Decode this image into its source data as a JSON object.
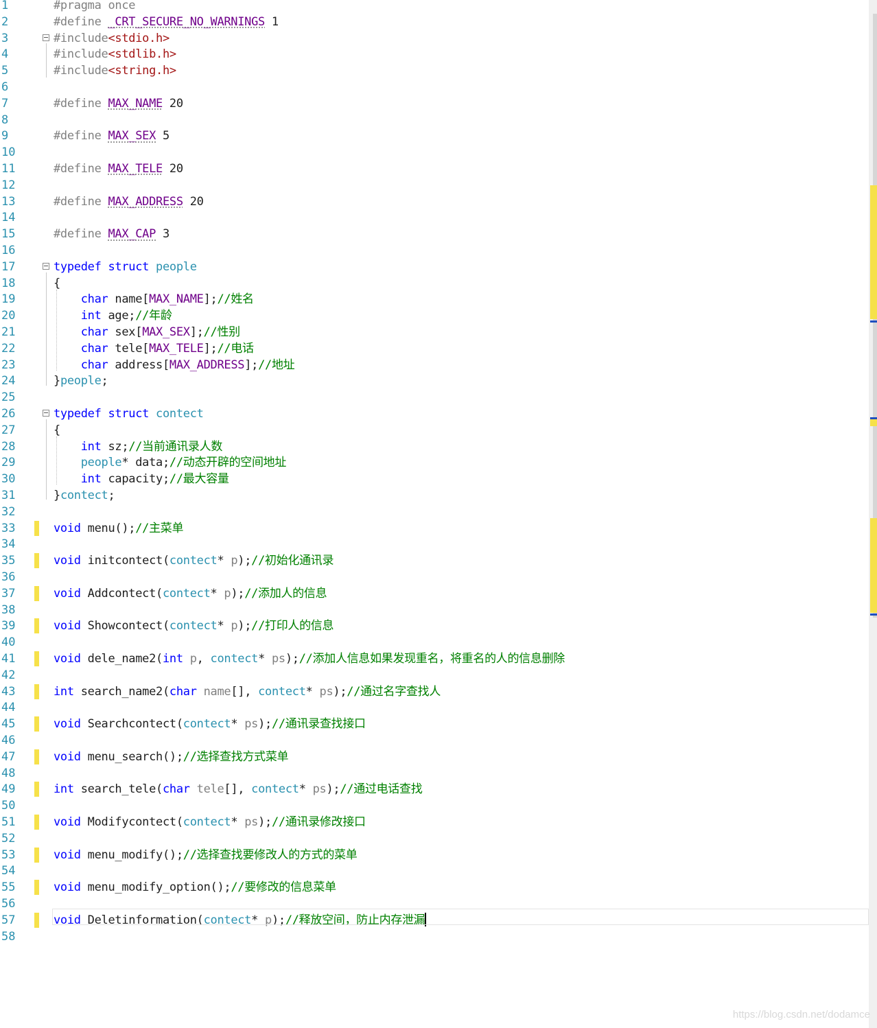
{
  "editor": {
    "lines": [
      {
        "n": "1",
        "segs": [
          {
            "c": "pp",
            "t": "#pragma once"
          }
        ]
      },
      {
        "n": "2",
        "segs": [
          {
            "c": "pp",
            "t": "#define "
          },
          {
            "c": "mc dots",
            "t": "_CRT_SECURE_NO_WARNINGS"
          },
          {
            "c": "",
            "t": " 1"
          }
        ]
      },
      {
        "n": "3",
        "fold": true,
        "segs": [
          {
            "c": "pp",
            "t": "#include"
          },
          {
            "c": "st",
            "t": "<stdio.h>"
          }
        ]
      },
      {
        "n": "4",
        "segs": [
          {
            "c": "pp",
            "t": "#include"
          },
          {
            "c": "st",
            "t": "<stdlib.h>"
          }
        ]
      },
      {
        "n": "5",
        "segs": [
          {
            "c": "pp",
            "t": "#include"
          },
          {
            "c": "st",
            "t": "<string.h>"
          }
        ]
      },
      {
        "n": "6",
        "segs": []
      },
      {
        "n": "7",
        "segs": [
          {
            "c": "pp",
            "t": "#define "
          },
          {
            "c": "mc dots",
            "t": "MAX_NAME"
          },
          {
            "c": "",
            "t": " 20"
          }
        ]
      },
      {
        "n": "8",
        "segs": []
      },
      {
        "n": "9",
        "segs": [
          {
            "c": "pp",
            "t": "#define "
          },
          {
            "c": "mc dots",
            "t": "MAX_SEX"
          },
          {
            "c": "",
            "t": " 5"
          }
        ]
      },
      {
        "n": "10",
        "segs": []
      },
      {
        "n": "11",
        "segs": [
          {
            "c": "pp",
            "t": "#define "
          },
          {
            "c": "mc dots",
            "t": "MAX_TELE"
          },
          {
            "c": "",
            "t": " 20"
          }
        ]
      },
      {
        "n": "12",
        "segs": []
      },
      {
        "n": "13",
        "segs": [
          {
            "c": "pp",
            "t": "#define "
          },
          {
            "c": "mc dots",
            "t": "MAX_ADDRESS"
          },
          {
            "c": "",
            "t": " 20"
          }
        ]
      },
      {
        "n": "14",
        "segs": []
      },
      {
        "n": "15",
        "segs": [
          {
            "c": "pp",
            "t": "#define "
          },
          {
            "c": "mc dots",
            "t": "MAX_CAP"
          },
          {
            "c": "",
            "t": " 3"
          }
        ]
      },
      {
        "n": "16",
        "segs": []
      },
      {
        "n": "17",
        "fold": true,
        "segs": [
          {
            "c": "kw",
            "t": "typedef"
          },
          {
            "c": "",
            "t": " "
          },
          {
            "c": "kw",
            "t": "struct"
          },
          {
            "c": "",
            "t": " "
          },
          {
            "c": "ty",
            "t": "people"
          }
        ]
      },
      {
        "n": "18",
        "segs": [
          {
            "c": "",
            "t": "{"
          }
        ]
      },
      {
        "n": "19",
        "segs": [
          {
            "c": "",
            "t": "    "
          },
          {
            "c": "kw",
            "t": "char"
          },
          {
            "c": "",
            "t": " name["
          },
          {
            "c": "mc",
            "t": "MAX_NAME"
          },
          {
            "c": "",
            "t": "];"
          },
          {
            "c": "cm",
            "t": "//姓名"
          }
        ]
      },
      {
        "n": "20",
        "segs": [
          {
            "c": "",
            "t": "    "
          },
          {
            "c": "kw",
            "t": "int"
          },
          {
            "c": "",
            "t": " age;"
          },
          {
            "c": "cm",
            "t": "//年龄"
          }
        ]
      },
      {
        "n": "21",
        "segs": [
          {
            "c": "",
            "t": "    "
          },
          {
            "c": "kw",
            "t": "char"
          },
          {
            "c": "",
            "t": " sex["
          },
          {
            "c": "mc",
            "t": "MAX_SEX"
          },
          {
            "c": "",
            "t": "];"
          },
          {
            "c": "cm",
            "t": "//性别"
          }
        ]
      },
      {
        "n": "22",
        "segs": [
          {
            "c": "",
            "t": "    "
          },
          {
            "c": "kw",
            "t": "char"
          },
          {
            "c": "",
            "t": " tele["
          },
          {
            "c": "mc",
            "t": "MAX_TELE"
          },
          {
            "c": "",
            "t": "];"
          },
          {
            "c": "cm",
            "t": "//电话"
          }
        ]
      },
      {
        "n": "23",
        "segs": [
          {
            "c": "",
            "t": "    "
          },
          {
            "c": "kw",
            "t": "char"
          },
          {
            "c": "",
            "t": " address["
          },
          {
            "c": "mc",
            "t": "MAX_ADDRESS"
          },
          {
            "c": "",
            "t": "];"
          },
          {
            "c": "cm",
            "t": "//地址"
          }
        ]
      },
      {
        "n": "24",
        "segs": [
          {
            "c": "",
            "t": "}"
          },
          {
            "c": "ty",
            "t": "people"
          },
          {
            "c": "",
            "t": ";"
          }
        ]
      },
      {
        "n": "25",
        "segs": []
      },
      {
        "n": "26",
        "fold": true,
        "segs": [
          {
            "c": "kw",
            "t": "typedef"
          },
          {
            "c": "",
            "t": " "
          },
          {
            "c": "kw",
            "t": "struct"
          },
          {
            "c": "",
            "t": " "
          },
          {
            "c": "ty",
            "t": "contect"
          }
        ]
      },
      {
        "n": "27",
        "segs": [
          {
            "c": "",
            "t": "{"
          }
        ]
      },
      {
        "n": "28",
        "segs": [
          {
            "c": "",
            "t": "    "
          },
          {
            "c": "kw",
            "t": "int"
          },
          {
            "c": "",
            "t": " sz;"
          },
          {
            "c": "cm",
            "t": "//当前通讯录人数"
          }
        ]
      },
      {
        "n": "29",
        "segs": [
          {
            "c": "",
            "t": "    "
          },
          {
            "c": "ty",
            "t": "people"
          },
          {
            "c": "",
            "t": "* data;"
          },
          {
            "c": "cm",
            "t": "//动态开辟的空间地址"
          }
        ]
      },
      {
        "n": "30",
        "segs": [
          {
            "c": "",
            "t": "    "
          },
          {
            "c": "kw",
            "t": "int"
          },
          {
            "c": "",
            "t": " capacity;"
          },
          {
            "c": "cm",
            "t": "//最大容量"
          }
        ]
      },
      {
        "n": "31",
        "segs": [
          {
            "c": "",
            "t": "}"
          },
          {
            "c": "ty",
            "t": "contect"
          },
          {
            "c": "",
            "t": ";"
          }
        ]
      },
      {
        "n": "32",
        "segs": []
      },
      {
        "n": "33",
        "chg": true,
        "segs": [
          {
            "c": "kw",
            "t": "void"
          },
          {
            "c": "",
            "t": " menu();"
          },
          {
            "c": "cm",
            "t": "//主菜单"
          }
        ]
      },
      {
        "n": "34",
        "segs": []
      },
      {
        "n": "35",
        "chg": true,
        "segs": [
          {
            "c": "kw",
            "t": "void"
          },
          {
            "c": "",
            "t": " initcontect("
          },
          {
            "c": "ty",
            "t": "contect"
          },
          {
            "c": "",
            "t": "* "
          },
          {
            "c": "pp",
            "t": "p"
          },
          {
            "c": "",
            "t": ");"
          },
          {
            "c": "cm",
            "t": "//初始化通讯录"
          }
        ]
      },
      {
        "n": "36",
        "segs": []
      },
      {
        "n": "37",
        "chg": true,
        "segs": [
          {
            "c": "kw",
            "t": "void"
          },
          {
            "c": "",
            "t": " Addcontect("
          },
          {
            "c": "ty",
            "t": "contect"
          },
          {
            "c": "",
            "t": "* "
          },
          {
            "c": "pp",
            "t": "p"
          },
          {
            "c": "",
            "t": ");"
          },
          {
            "c": "cm",
            "t": "//添加人的信息"
          }
        ]
      },
      {
        "n": "38",
        "segs": []
      },
      {
        "n": "39",
        "chg": true,
        "segs": [
          {
            "c": "kw",
            "t": "void"
          },
          {
            "c": "",
            "t": " Showcontect("
          },
          {
            "c": "ty",
            "t": "contect"
          },
          {
            "c": "",
            "t": "* "
          },
          {
            "c": "pp",
            "t": "p"
          },
          {
            "c": "",
            "t": ");"
          },
          {
            "c": "cm",
            "t": "//打印人的信息"
          }
        ]
      },
      {
        "n": "40",
        "segs": []
      },
      {
        "n": "41",
        "chg": true,
        "segs": [
          {
            "c": "kw",
            "t": "void"
          },
          {
            "c": "",
            "t": " dele_name2("
          },
          {
            "c": "kw",
            "t": "int"
          },
          {
            "c": "",
            "t": " "
          },
          {
            "c": "pp",
            "t": "p"
          },
          {
            "c": "",
            "t": ", "
          },
          {
            "c": "ty",
            "t": "contect"
          },
          {
            "c": "",
            "t": "* "
          },
          {
            "c": "pp",
            "t": "ps"
          },
          {
            "c": "",
            "t": ");"
          },
          {
            "c": "cm",
            "t": "//添加人信息如果发现重名，将重名的人的信息删除"
          }
        ]
      },
      {
        "n": "42",
        "segs": []
      },
      {
        "n": "43",
        "chg": true,
        "segs": [
          {
            "c": "kw",
            "t": "int"
          },
          {
            "c": "",
            "t": " search_name2("
          },
          {
            "c": "kw",
            "t": "char"
          },
          {
            "c": "",
            "t": " "
          },
          {
            "c": "pp",
            "t": "name"
          },
          {
            "c": "",
            "t": "[], "
          },
          {
            "c": "ty",
            "t": "contect"
          },
          {
            "c": "",
            "t": "* "
          },
          {
            "c": "pp",
            "t": "ps"
          },
          {
            "c": "",
            "t": ");"
          },
          {
            "c": "cm",
            "t": "//通过名字查找人"
          }
        ]
      },
      {
        "n": "44",
        "segs": []
      },
      {
        "n": "45",
        "chg": true,
        "segs": [
          {
            "c": "kw",
            "t": "void"
          },
          {
            "c": "",
            "t": " Searchcontect("
          },
          {
            "c": "ty",
            "t": "contect"
          },
          {
            "c": "",
            "t": "* "
          },
          {
            "c": "pp",
            "t": "ps"
          },
          {
            "c": "",
            "t": ");"
          },
          {
            "c": "cm",
            "t": "//通讯录查找接口"
          }
        ]
      },
      {
        "n": "46",
        "segs": []
      },
      {
        "n": "47",
        "chg": true,
        "segs": [
          {
            "c": "kw",
            "t": "void"
          },
          {
            "c": "",
            "t": " menu_search();"
          },
          {
            "c": "cm",
            "t": "//选择查找方式菜单"
          }
        ]
      },
      {
        "n": "48",
        "segs": []
      },
      {
        "n": "49",
        "chg": true,
        "segs": [
          {
            "c": "kw",
            "t": "int"
          },
          {
            "c": "",
            "t": " search_tele("
          },
          {
            "c": "kw",
            "t": "char"
          },
          {
            "c": "",
            "t": " "
          },
          {
            "c": "pp",
            "t": "tele"
          },
          {
            "c": "",
            "t": "[], "
          },
          {
            "c": "ty",
            "t": "contect"
          },
          {
            "c": "",
            "t": "* "
          },
          {
            "c": "pp",
            "t": "ps"
          },
          {
            "c": "",
            "t": ");"
          },
          {
            "c": "cm",
            "t": "//通过电话查找"
          }
        ]
      },
      {
        "n": "50",
        "segs": []
      },
      {
        "n": "51",
        "chg": true,
        "segs": [
          {
            "c": "kw",
            "t": "void"
          },
          {
            "c": "",
            "t": " Modifycontect("
          },
          {
            "c": "ty",
            "t": "contect"
          },
          {
            "c": "",
            "t": "* "
          },
          {
            "c": "pp",
            "t": "ps"
          },
          {
            "c": "",
            "t": ");"
          },
          {
            "c": "cm",
            "t": "//通讯录修改接口"
          }
        ]
      },
      {
        "n": "52",
        "segs": []
      },
      {
        "n": "53",
        "chg": true,
        "segs": [
          {
            "c": "kw",
            "t": "void"
          },
          {
            "c": "",
            "t": " menu_modify();"
          },
          {
            "c": "cm",
            "t": "//选择查找要修改人的方式的菜单"
          }
        ]
      },
      {
        "n": "54",
        "segs": []
      },
      {
        "n": "55",
        "chg": true,
        "segs": [
          {
            "c": "kw",
            "t": "void"
          },
          {
            "c": "",
            "t": " menu_modify_option();"
          },
          {
            "c": "cm",
            "t": "//要修改的信息菜单"
          }
        ]
      },
      {
        "n": "56",
        "segs": []
      },
      {
        "n": "57",
        "chg": true,
        "caret": true,
        "segs": [
          {
            "c": "kw",
            "t": "void"
          },
          {
            "c": "",
            "t": " Deletinformation("
          },
          {
            "c": "ty",
            "t": "contect"
          },
          {
            "c": "",
            "t": "* "
          },
          {
            "c": "pp",
            "t": "p"
          },
          {
            "c": "",
            "t": ");"
          },
          {
            "c": "cm",
            "t": "//释放空间，防止内存泄漏"
          }
        ]
      },
      {
        "n": "58",
        "segs": []
      }
    ]
  },
  "colors": {
    "keyword": "#0000ff",
    "type": "#2b91af",
    "macro": "#6f008a",
    "comment": "#008000",
    "preprocessor": "#808080",
    "include_path": "#a31515",
    "line_number": "#2b91af",
    "change_marker": "#f6e14a"
  },
  "watermark": "https://blog.csdn.net/dodamce"
}
